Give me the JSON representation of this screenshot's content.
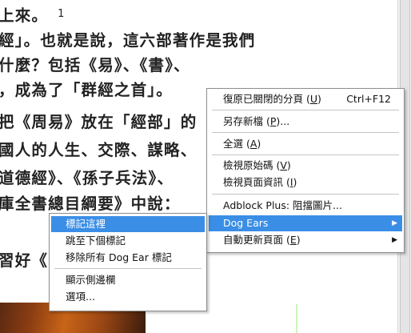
{
  "page": {
    "lines": [
      {
        "text": "上來。",
        "note": "1"
      },
      {
        "text": "經」。也就是說，這六部著作是我們"
      },
      {
        "text": "什麼？包括《易》、《書》、"
      },
      {
        "text": "，成為了「群經之首」。"
      },
      {
        "text": "把《周易》放在「經部」的"
      },
      {
        "text": "國人的人生、交際、謀略、"
      },
      {
        "text": "道德經》、《孫子兵法》、"
      },
      {
        "text": "庫全書總目綱要》中說："
      },
      {
        "text": ""
      },
      {
        "text": "習好《"
      }
    ]
  },
  "context_menu": {
    "items": [
      {
        "pre": "復原已關閉的分頁 (",
        "key": "U",
        "post": ")",
        "shortcut": "Ctrl+F12"
      },
      {
        "pre": "另存新檔 (",
        "key": "P",
        "post": ")..."
      },
      {
        "pre": "全選 (",
        "key": "A",
        "post": ")"
      },
      {
        "pre": "檢視原始碼 (",
        "key": "V",
        "post": ")"
      },
      {
        "pre": "檢視頁面資訊 (",
        "key": "I",
        "post": ")"
      },
      {
        "pre": "Adblock Plus: 阻擋圖片...",
        "key": "",
        "post": ""
      },
      {
        "pre": "Dog Ears",
        "key": "",
        "post": "",
        "submenu": true,
        "selected": true
      },
      {
        "pre": "自動更新頁面 (",
        "key": "E",
        "post": ")",
        "submenu": true
      }
    ],
    "arrow": "▶"
  },
  "dog_ears_submenu": {
    "items": [
      {
        "label": "標記這裡",
        "selected": true
      },
      {
        "label": "跳至下個標記"
      },
      {
        "label": "移除所有 Dog Ear 標記"
      },
      {
        "label": "顯示側邊欄"
      },
      {
        "label": "選項..."
      }
    ]
  },
  "colors": {
    "highlight": "#3a8ee6",
    "menu_border": "#8e8e8e",
    "text": "#222222"
  }
}
